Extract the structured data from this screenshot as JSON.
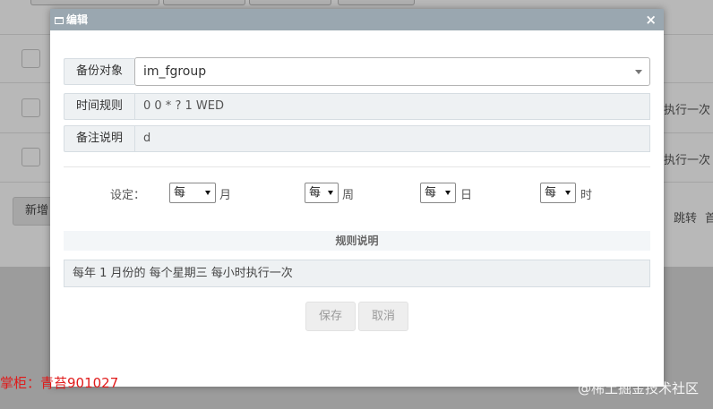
{
  "background": {
    "row1_action": "执行一次",
    "row2_action": "执行一次",
    "new_button": "新增",
    "pager_jump": "跳转",
    "pager_tail": "首"
  },
  "modal": {
    "title": "编辑",
    "close_glyph": "×",
    "fields": {
      "backup_target_label": "备份对象",
      "backup_target_value": "im_fgroup",
      "time_rule_label": "时间规则",
      "time_rule_value": "0 0 * ? 1 WED",
      "note_label": "备注说明",
      "note_value": "d"
    },
    "settings": {
      "label": "设定：",
      "month": {
        "selected": "每",
        "unit": "月"
      },
      "week": {
        "selected": "每",
        "unit": "周"
      },
      "day": {
        "selected": "每",
        "unit": "日"
      },
      "hour": {
        "selected": "每",
        "unit": "时"
      }
    },
    "rule": {
      "title": "规则说明",
      "description": "每年 1 月份的 每个星期三  每小时执行一次"
    },
    "buttons": {
      "save": "保存",
      "cancel": "取消"
    }
  },
  "overlay_text": {
    "shopkeeper": "掌柜：青苔901027",
    "watermark": "@稀土掘金技术社区"
  },
  "colors": {
    "header": "#9aa7b0",
    "shopkeeper": "#e01a1a"
  }
}
